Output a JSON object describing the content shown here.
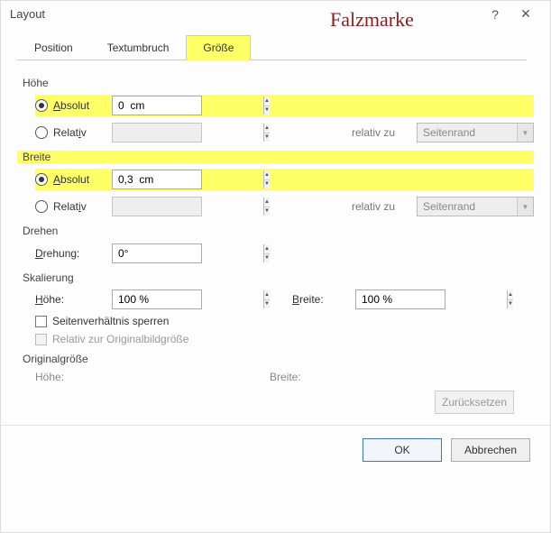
{
  "title": "Layout",
  "annotation": "Falzmarke",
  "tabs": {
    "position": "Position",
    "textwrap": "Textumbruch",
    "size": "Größe"
  },
  "sections": {
    "height": "Höhe",
    "width": "Breite",
    "rotate": "Drehen",
    "scale": "Skalierung",
    "origsize": "Originalgröße"
  },
  "labels": {
    "absolute": "bsolut",
    "absolute_prefix": "A",
    "relative": "Relat",
    "relative_suffix": "i",
    "relative_suffix2": "v",
    "relative_to": "relativ zu",
    "rotation_d": "D",
    "rotation_rest": "rehung:",
    "scale_h_h": "H",
    "scale_h_rest": "öhe:",
    "scale_w_b": "B",
    "scale_w_rest": "reite:",
    "lock_aspect": "Seitenverhältnis sperren",
    "relative_orig": "Relativ zur Originalbildgröße",
    "orig_h": "Höhe:",
    "orig_w": "Breite:"
  },
  "values": {
    "height_abs": "0  cm",
    "width_abs": "0,3  cm",
    "rotation": "0°",
    "scale_h": "100 %",
    "scale_w": "100 %",
    "rel_dd": "Seitenrand"
  },
  "buttons": {
    "reset": "Zurücksetzen",
    "ok": "OK",
    "cancel": "Abbrechen"
  }
}
